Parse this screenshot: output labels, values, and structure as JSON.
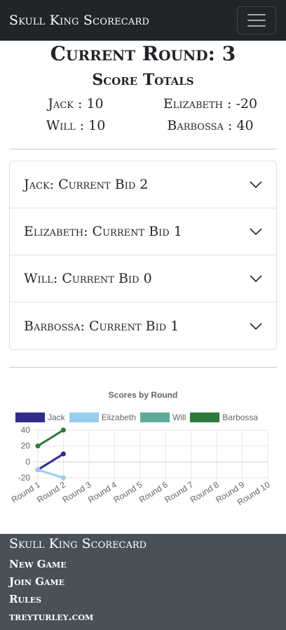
{
  "navbar": {
    "brand": "Skull King Scorecard"
  },
  "round": {
    "title": "Current Round: 3"
  },
  "totals": {
    "title": "Score Totals",
    "players": [
      {
        "text": "Jack : 10"
      },
      {
        "text": "Elizabeth : -20"
      },
      {
        "text": "Will : 10"
      },
      {
        "text": "Barbossa : 40"
      }
    ]
  },
  "bids": [
    {
      "label": "Jack: Current Bid 2"
    },
    {
      "label": "Elizabeth: Current Bid 1"
    },
    {
      "label": "Will: Current Bid 0"
    },
    {
      "label": "Barbossa: Current Bid 1"
    }
  ],
  "chart_data": {
    "type": "line",
    "title": "Scores by Round",
    "categories": [
      "Round 1",
      "Round 2",
      "Round 3",
      "Round 4",
      "Round 5",
      "Round 6",
      "Round 7",
      "Round 8",
      "Round 9",
      "Round 10"
    ],
    "series": [
      {
        "name": "Jack",
        "color": "#312b8a",
        "values": [
          -10,
          10
        ]
      },
      {
        "name": "Elizabeth",
        "color": "#97ceeb",
        "values": [
          -10,
          -20
        ]
      },
      {
        "name": "Will",
        "color": "#5fa99a",
        "values": []
      },
      {
        "name": "Barbossa",
        "color": "#2e7a3a",
        "values": [
          20,
          40
        ]
      }
    ],
    "ylim": [
      -20,
      40
    ],
    "yticks": [
      40,
      20,
      0,
      -20
    ],
    "grid": true,
    "legend": "top"
  },
  "footer": {
    "brand": "Skull King Scorecard",
    "links": [
      {
        "label": "New Game"
      },
      {
        "label": "Join Game"
      },
      {
        "label": "Rules"
      },
      {
        "label": "treyturley.com"
      }
    ]
  }
}
